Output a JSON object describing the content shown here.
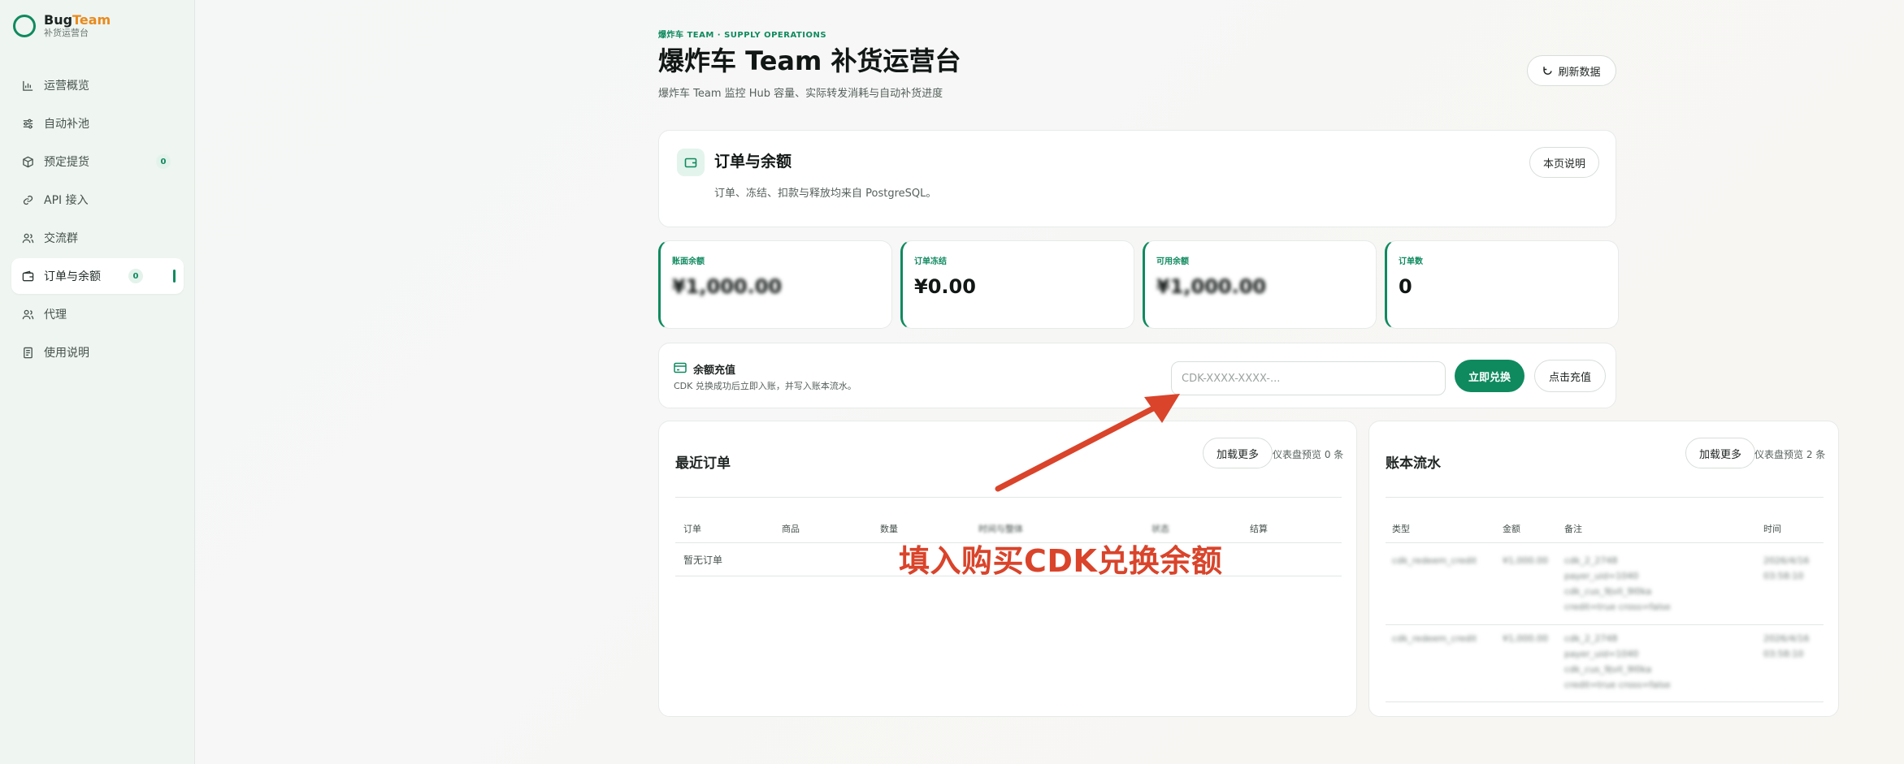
{
  "app": {
    "brand_part1": "Bug",
    "brand_part2": "Team",
    "brand_sub": "补货运营台",
    "brand_color": "#0f8a5f",
    "brand_accent": "#e98a1c"
  },
  "sidebar": {
    "items": [
      {
        "label": "运营概览",
        "icon": "bar-chart-icon"
      },
      {
        "label": "自动补池",
        "icon": "sliders-icon"
      },
      {
        "label": "预定提货",
        "icon": "box-icon",
        "badge": "0"
      },
      {
        "label": "API 接入",
        "icon": "link-icon"
      },
      {
        "label": "交流群",
        "icon": "users-icon"
      },
      {
        "label": "订单与余额",
        "icon": "wallet-icon",
        "badge": "0",
        "active": true
      },
      {
        "label": "代理",
        "icon": "users-icon"
      },
      {
        "label": "使用说明",
        "icon": "doc-icon"
      }
    ]
  },
  "header": {
    "eyebrow": "爆炸车 TEAM · SUPPLY OPERATIONS",
    "title": "爆炸车 Team 补货运营台",
    "subtitle": "爆炸车 Team 监控 Hub 容量、实际转发消耗与自动补货进度",
    "refresh_label": "刷新数据"
  },
  "orders_section": {
    "title": "订单与余额",
    "subtitle": "订单、冻结、扣款与释放均来自 PostgreSQL。",
    "help_label": "本页说明"
  },
  "stats": [
    {
      "label": "账面余额",
      "value": "¥1,000.00",
      "blurred": true
    },
    {
      "label": "订单冻结",
      "value": "¥0.00",
      "blurred": false
    },
    {
      "label": "可用余额",
      "value": "¥1,000.00",
      "blurred": true
    },
    {
      "label": "订单数",
      "value": "0",
      "blurred": false
    }
  ],
  "recharge": {
    "title": "余额充值",
    "subtitle": "CDK 兑换成功后立即入账，并写入账本流水。",
    "input_placeholder": "CDK-XXXX-XXXX-...",
    "redeem_label": "立即兑换",
    "pay_label": "点击充值"
  },
  "recent_orders": {
    "title": "最近订单",
    "load_more_label": "加载更多",
    "preview_text": "仪表盘预览 0 条",
    "columns": [
      "订单",
      "商品",
      "数量",
      "时间与整体",
      "状态",
      "结算"
    ],
    "empty_text": "暂无订单"
  },
  "ledger": {
    "title": "账本流水",
    "load_more_label": "加载更多",
    "preview_text": "仪表盘预览 2 条",
    "columns": [
      "类型",
      "金额",
      "备注",
      "时间"
    ],
    "rows": [
      {
        "type": "cdk_redeem_credit",
        "amount": "¥1,000.00",
        "note": [
          "cdk_2_2748",
          "payer_uid=1040",
          "cdk_cus_9jvll_9l0ka",
          "credit=true cross=false"
        ],
        "time": [
          "2026/4/16",
          "03:58:10"
        ]
      },
      {
        "type": "cdk_redeem_credit",
        "amount": "¥1,000.00",
        "note": [
          "cdk_2_2748",
          "payer_uid=1040",
          "cdk_cus_9jvll_9l0ka",
          "credit=true cross=false"
        ],
        "time": [
          "2026/4/16",
          "03:58:10"
        ]
      }
    ]
  },
  "annotation": {
    "text": "填入购买CDK兑换余额",
    "color": "#d9442b"
  }
}
